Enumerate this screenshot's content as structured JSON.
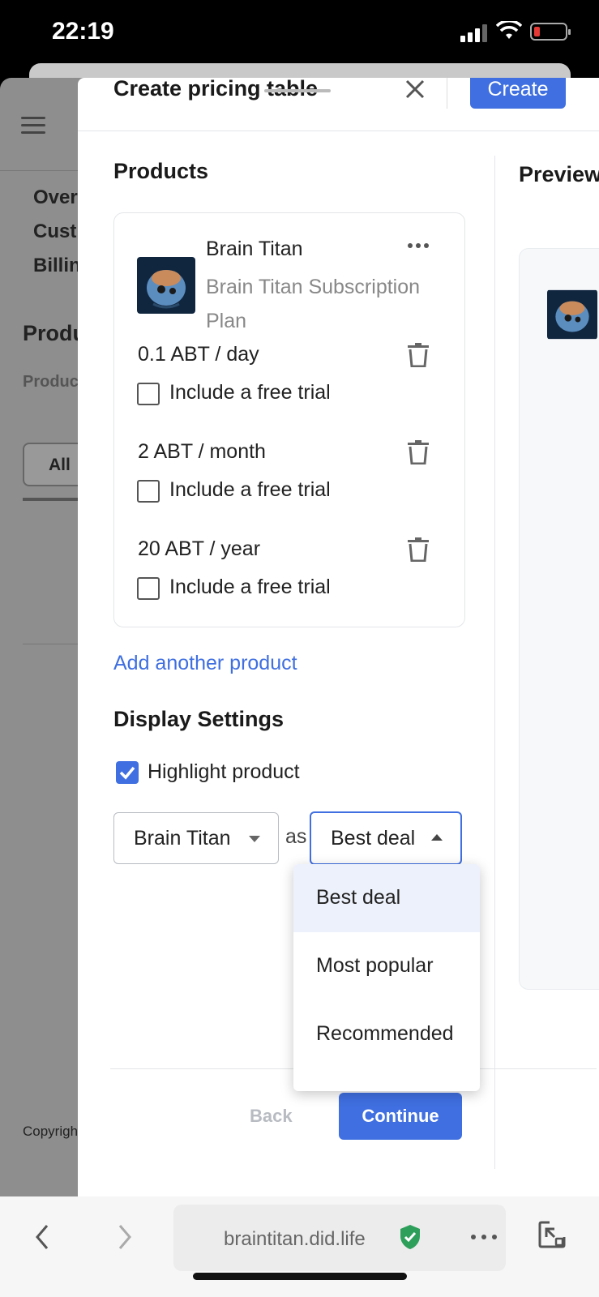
{
  "status_bar": {
    "time": "22:19"
  },
  "background_page": {
    "nav_items": [
      "Over",
      "Cust",
      "Billin"
    ],
    "products_title": "Produ",
    "products_sub": "Produc",
    "filter_all": "All",
    "copyright": "Copyrigh"
  },
  "modal": {
    "title": "Create pricing table",
    "create_label": "Create",
    "products_section_title": "Products",
    "preview_title": "Preview",
    "product": {
      "name": "Brain Titan",
      "description": "Brain Titan Subscription Plan",
      "prices": [
        {
          "label": "0.1 ABT / day",
          "trial_label": "Include a free trial",
          "trial_checked": false
        },
        {
          "label": "2 ABT / month",
          "trial_label": "Include a free trial",
          "trial_checked": false
        },
        {
          "label": "20 ABT / year",
          "trial_label": "Include a free trial",
          "trial_checked": false
        }
      ]
    },
    "add_product_label": "Add another product",
    "display_settings_title": "Display Settings",
    "highlight_label": "Highlight product",
    "highlight_checked": true,
    "highlight_product_value": "Brain Titan",
    "as_label": "as",
    "highlight_type_value": "Best deal",
    "dropdown_options": [
      "Best deal",
      "Most popular",
      "Recommended"
    ],
    "back_label": "Back",
    "continue_label": "Continue"
  },
  "browser": {
    "url": "braintitan.did.life"
  },
  "colors": {
    "accent": "#3f6fe0",
    "secure": "#2e9e5b",
    "battery_low": "#e53935"
  }
}
